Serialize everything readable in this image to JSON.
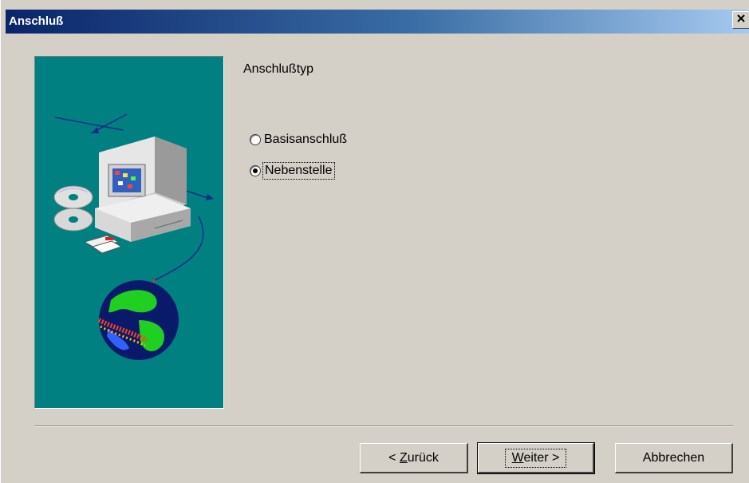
{
  "window": {
    "title": "Anschluß",
    "close_icon": "close-icon"
  },
  "content": {
    "section_title": "Anschlußtyp",
    "options": [
      {
        "label": "Basisanschluß",
        "selected": false
      },
      {
        "label": "Nebenstelle",
        "selected": true
      }
    ]
  },
  "buttons": {
    "back_prefix": "< ",
    "back_accel": "Z",
    "back_rest": "urück",
    "next_accel": "W",
    "next_rest": "eiter >",
    "cancel_label": "Abbrechen"
  },
  "colors": {
    "dialog_bg": "#d4d0c8",
    "panel_bg": "#008080",
    "title_gradient_start": "#0a246a",
    "title_gradient_end": "#a6caf0"
  },
  "illustration": {
    "icons": [
      "computer-icon",
      "cd-disc-icon",
      "floppy-disk-icon",
      "globe-icon"
    ]
  }
}
